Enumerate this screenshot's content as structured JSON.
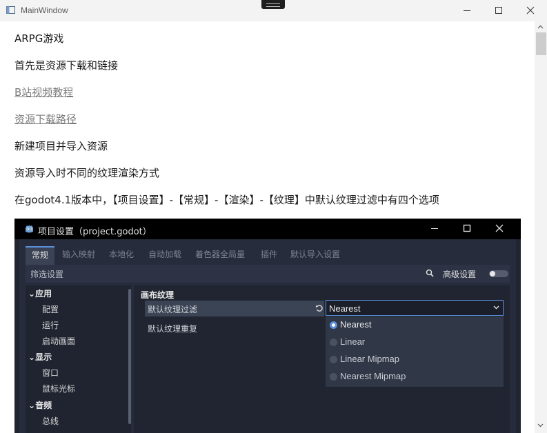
{
  "window": {
    "title": "MainWindow"
  },
  "paragraphs": [
    "ARPG游戏",
    "首先是资源下载和链接",
    "B站视频教程",
    "资源下载路径",
    "新建项目并导入资源",
    "资源导入时不同的纹理渲染方式",
    "在godot4.1版本中，【项目设置】-【常规】-【渲染】-【纹理】中默认纹理过滤中有四个选项"
  ],
  "godot": {
    "dialog_title": "项目设置（project.godot）",
    "tabs": [
      "常规",
      "输入映射",
      "本地化",
      "自动加载",
      "着色器全局量",
      "插件",
      "默认导入设置"
    ],
    "filter_placeholder": "筛选设置",
    "advanced_label": "高级设置",
    "tree": [
      {
        "label": "应用",
        "kind": "section"
      },
      {
        "label": "配置",
        "kind": "child"
      },
      {
        "label": "运行",
        "kind": "child"
      },
      {
        "label": "启动画面",
        "kind": "child"
      },
      {
        "label": "显示",
        "kind": "section"
      },
      {
        "label": "窗口",
        "kind": "child"
      },
      {
        "label": "鼠标光标",
        "kind": "child"
      },
      {
        "label": "音频",
        "kind": "section"
      },
      {
        "label": "总线",
        "kind": "child"
      }
    ],
    "section_title": "画布纹理",
    "properties": [
      {
        "label": "默认纹理过滤"
      },
      {
        "label": "默认纹理重复"
      }
    ],
    "combo_value": "Nearest",
    "options": [
      {
        "label": "Nearest",
        "selected": true
      },
      {
        "label": "Linear",
        "selected": false
      },
      {
        "label": "Linear Mipmap",
        "selected": false
      },
      {
        "label": "Nearest Mipmap",
        "selected": false
      }
    ]
  },
  "icons": {
    "app": "window-app-icon",
    "minimize": "minimize-icon",
    "maximize": "maximize-icon",
    "close": "close-icon",
    "godot_logo": "godot-logo-icon",
    "search": "search-icon",
    "reset": "reset-icon",
    "chevron": "chevron-down-icon"
  },
  "colors": {
    "accent": "#5a8fd9",
    "godot_bg": "#262c3b",
    "link": "#7a7a7a"
  }
}
